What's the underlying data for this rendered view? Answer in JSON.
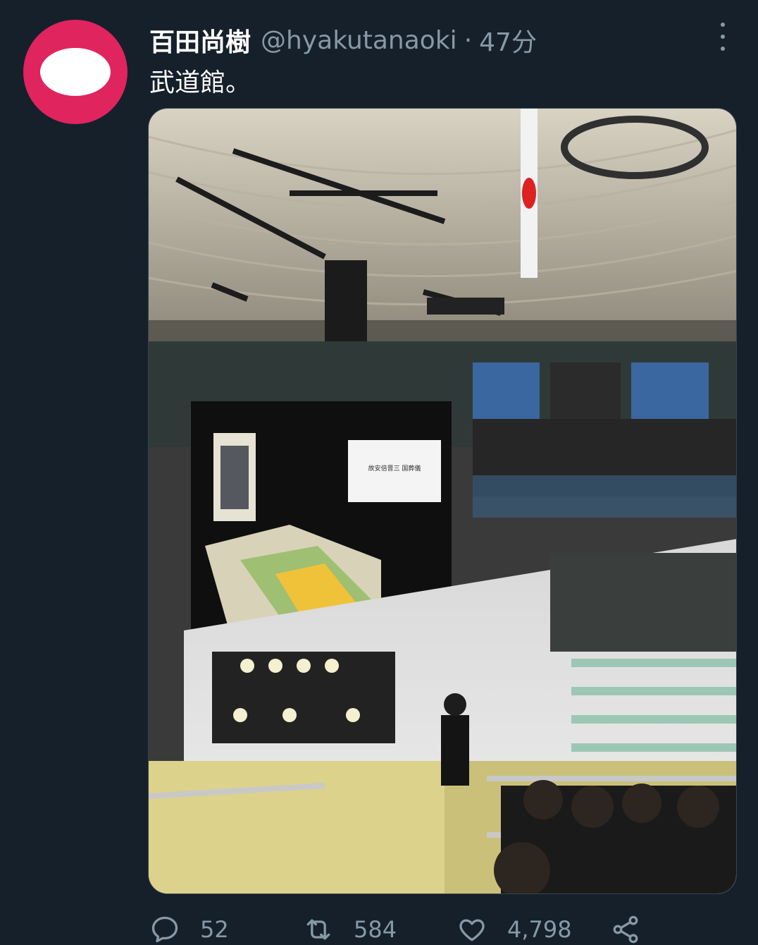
{
  "tweet": {
    "author_name": "百田尚樹",
    "author_handle": "@hyakutanaoki",
    "separator": "·",
    "time": "47分",
    "text": "武道館。",
    "avatar_color": "#e0245e"
  },
  "media": {
    "slide_title": "故安倍晋三 国葬儀"
  },
  "actions": {
    "reply_count": "52",
    "retweet_count": "584",
    "like_count": "4,798"
  },
  "icons": [
    "reply-icon",
    "retweet-icon",
    "like-icon",
    "share-icon",
    "more-icon"
  ],
  "colors": {
    "background": "#15202b",
    "secondary_text": "#8899a6",
    "primary_text": "#ffffff"
  }
}
